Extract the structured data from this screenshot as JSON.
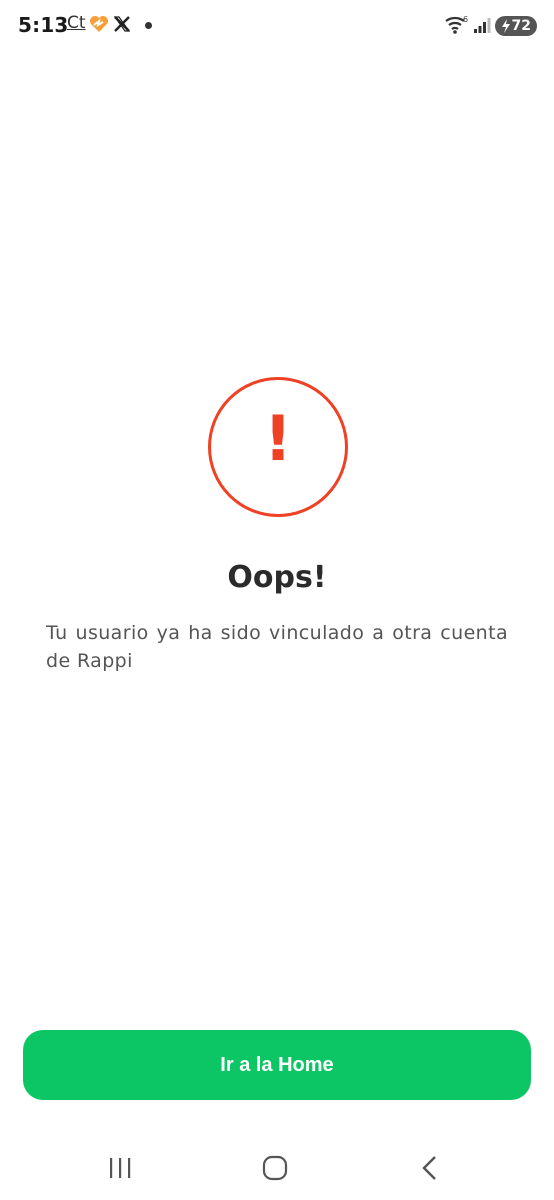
{
  "status_bar": {
    "time": "5:13",
    "ct_label": "Ct",
    "network_type": "6",
    "battery_level": "72",
    "icons": [
      "ct-icon",
      "heart-icon",
      "x-icon",
      "notification-dot-icon",
      "wifi-icon",
      "signal-icon",
      "battery-icon"
    ]
  },
  "alert": {
    "icon": "exclamation-icon",
    "mark": "!",
    "color": "#ef4123"
  },
  "title": "Oops!",
  "message": "Tu usuario ya ha sido vinculado a otra cuenta de Rappi",
  "button": {
    "label": "Ir a la Home",
    "color": "#0cc665"
  },
  "nav_bar": {
    "icons": [
      "recent-apps-icon",
      "home-icon",
      "back-icon"
    ]
  }
}
